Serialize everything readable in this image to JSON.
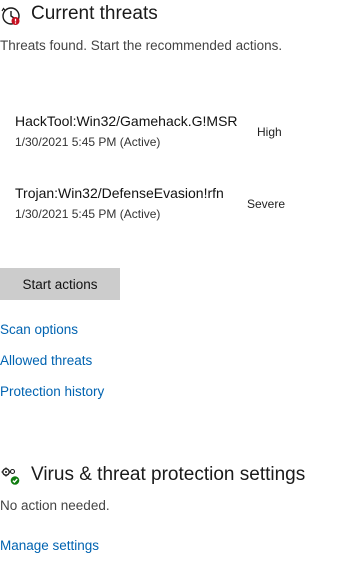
{
  "current_threats": {
    "title": "Current threats",
    "subtitle": "Threats found. Start the recommended actions.",
    "icon": "history-clock-icon",
    "threats": [
      {
        "name": "HackTool:Win32/Gamehack.G!MSR",
        "date": "1/30/2021 5:45 PM (Active)",
        "severity": "High"
      },
      {
        "name": "Trojan:Win32/DefenseEvasion!rfn",
        "date": "1/30/2021 5:45 PM (Active)",
        "severity": "Severe"
      }
    ],
    "start_actions_label": "Start actions",
    "links": {
      "scan_options": "Scan options",
      "allowed_threats": "Allowed threats",
      "protection_history": "Protection history"
    }
  },
  "settings_section": {
    "title": "Virus & threat protection settings",
    "icon": "settings-gears-check-icon",
    "status": "No action needed.",
    "manage_link": "Manage settings"
  },
  "colors": {
    "link": "#0063b1",
    "button_bg": "#cccccc",
    "alert_red": "#c50f1f",
    "ok_green": "#107c10"
  }
}
